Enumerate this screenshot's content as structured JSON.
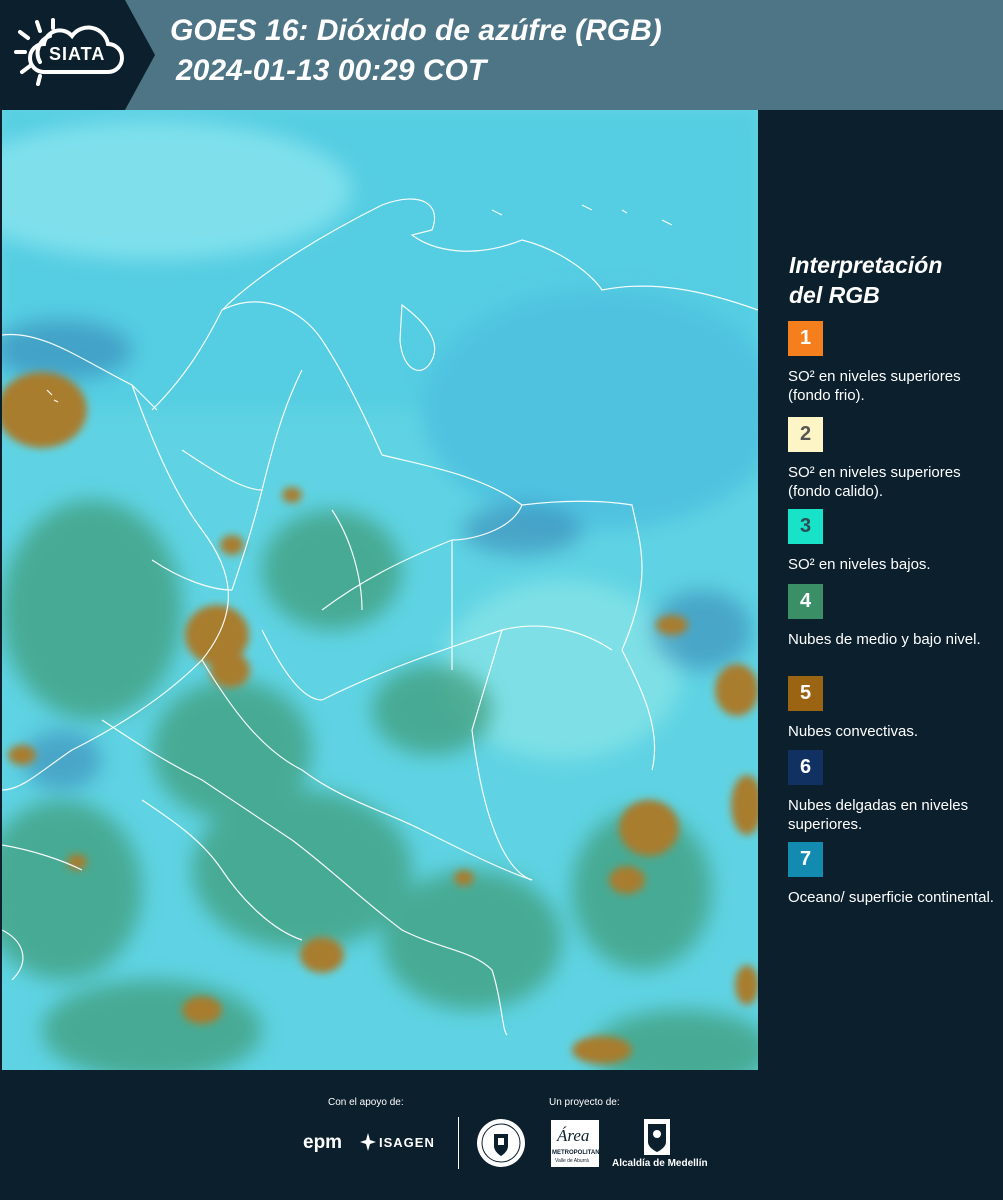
{
  "header": {
    "logo_text": "SIATA",
    "title_line1": "GOES 16: Dióxido de azúfre (RGB)",
    "title_line2": "2024-01-13 00:29 COT"
  },
  "legend": {
    "title_line1": "Interpretación",
    "title_line2": "del RGB",
    "items": [
      {
        "number": "1",
        "label": "SO² en niveles superiores (fondo frio).",
        "color": "#f57f1c",
        "text_color": "#ffffff"
      },
      {
        "number": "2",
        "label": "SO² en niveles superiores (fondo calido).",
        "color": "#fdf5c6",
        "text_color": "#555555"
      },
      {
        "number": "3",
        "label": "SO² en niveles bajos.",
        "color": "#18e3c8",
        "text_color": "#2b4d55"
      },
      {
        "number": "4",
        "label": "Nubes de medio y bajo nivel.",
        "color": "#3a8f67",
        "text_color": "#ffffff"
      },
      {
        "number": "5",
        "label": "Nubes convectivas.",
        "color": "#9a6413",
        "text_color": "#ffffff"
      },
      {
        "number": "6",
        "label": "Nubes delgadas en niveles superiores.",
        "color": "#123163",
        "text_color": "#ffffff"
      },
      {
        "number": "7",
        "label": "Oceano/ superficie continental.",
        "color": "#138ab0",
        "text_color": "#ffffff"
      }
    ]
  },
  "footer": {
    "support_label": "Con el apoyo de:",
    "project_label": "Un proyecto de:",
    "epm_logo": "epm",
    "isagen_logo": "ISAGEN",
    "area_logo_top": "Área",
    "area_logo_sub": "METROPOLITANA",
    "area_logo_sub2": "Valle de Aburrá",
    "alcaldia_logo": "Alcaldía de Medellín"
  },
  "icons": {
    "siata": "sun-cloud-icon",
    "isagen": "isagen-star-icon",
    "medellin": "medellin-seal-icon",
    "alcaldia": "coat-of-arms-icon"
  }
}
